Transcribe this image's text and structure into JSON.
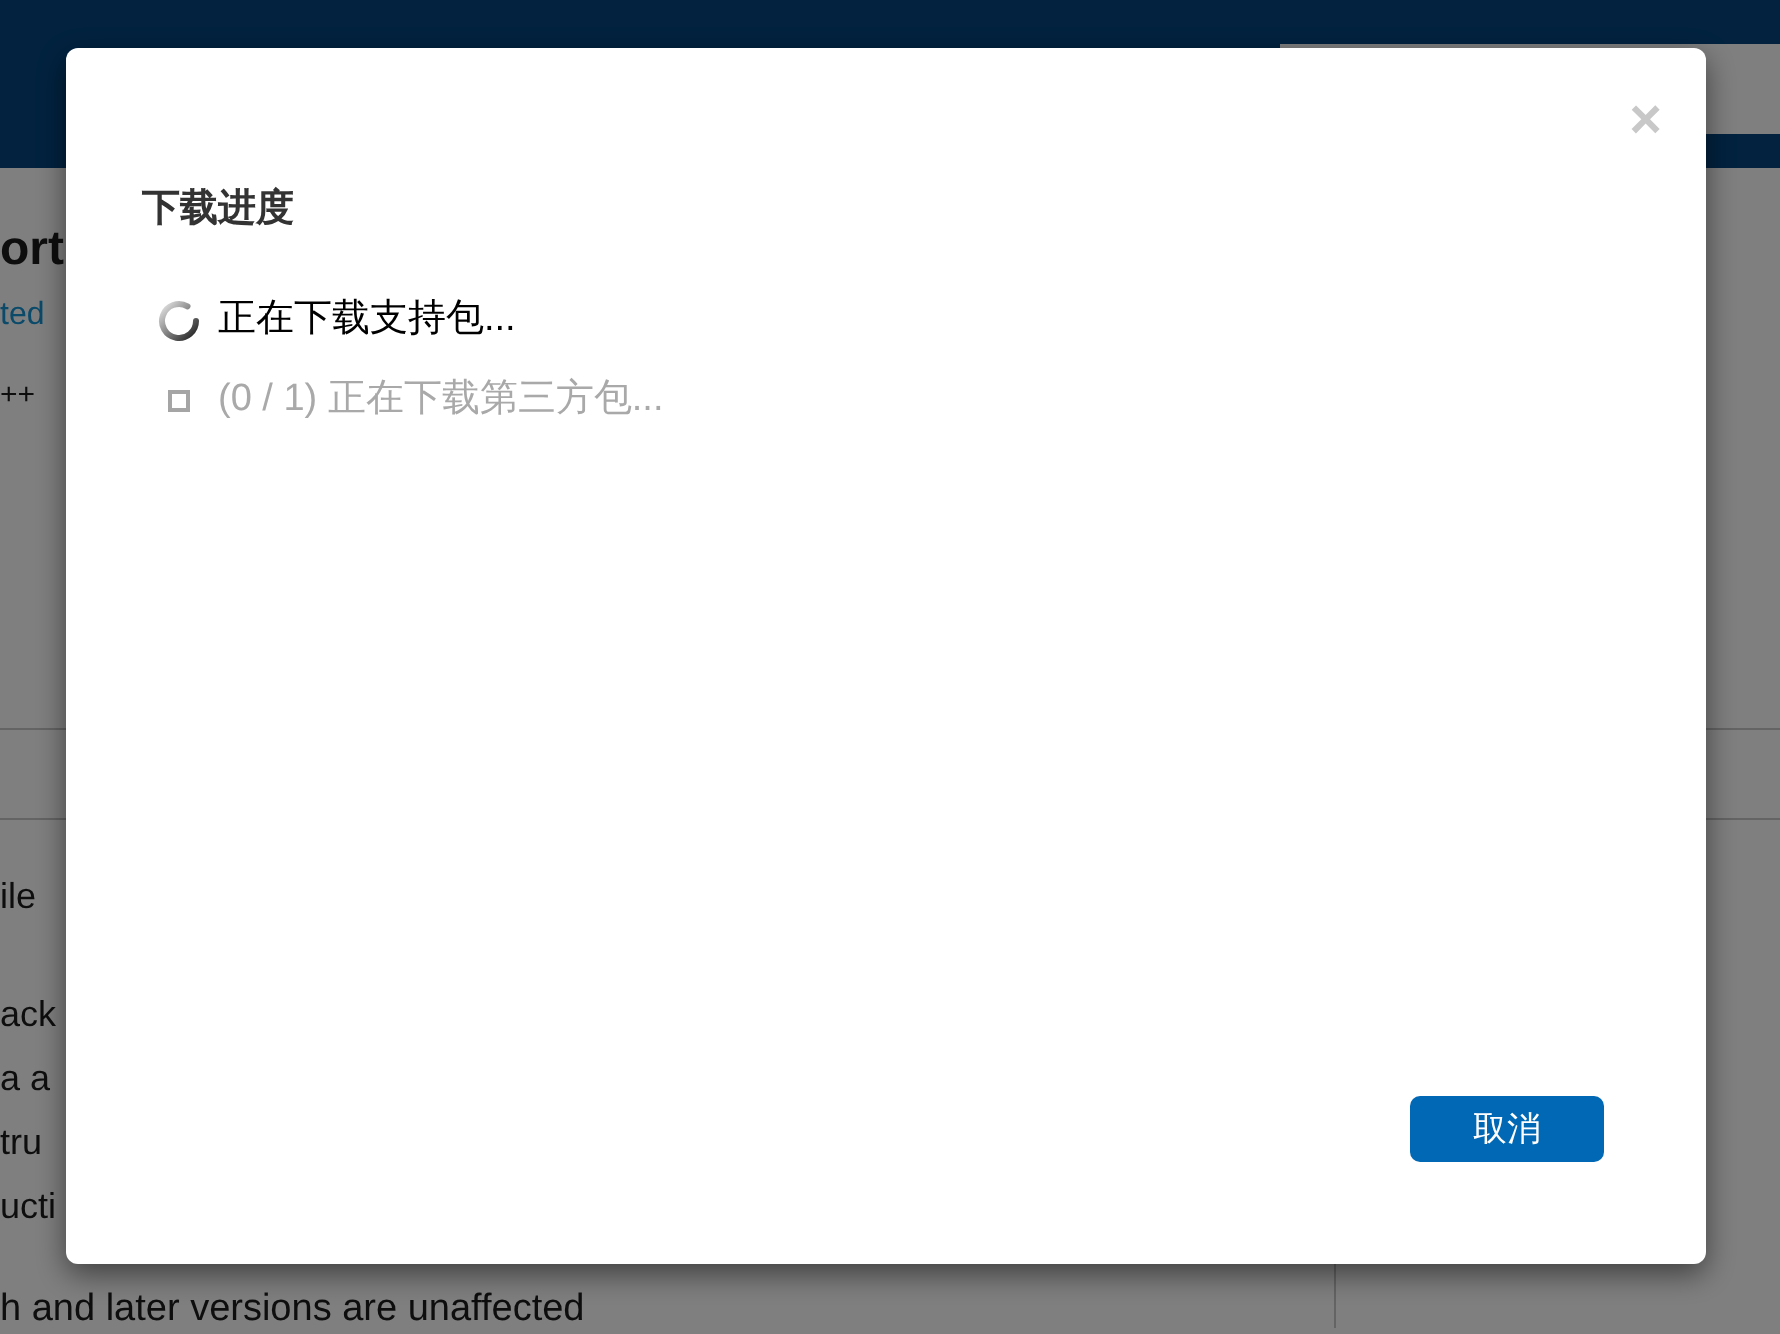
{
  "background_page": {
    "title_fragment": "ort",
    "link_fragment": "ted",
    "meta_fragment": "++",
    "paragraphs": [
      {
        "lines": [
          "ile"
        ]
      },
      {
        "lines": [
          "ack",
          "a a",
          "tru",
          "ucti"
        ]
      },
      {
        "lines": [
          "h and later versions are unaffected"
        ]
      }
    ]
  },
  "dialog": {
    "title": "下载进度",
    "close": "×",
    "steps": [
      {
        "text": "正在下载支持包...",
        "active": true
      },
      {
        "text": "(0 / 1) 正在下载第三方包...",
        "active": false
      }
    ],
    "buttons": [
      "取消"
    ]
  }
}
